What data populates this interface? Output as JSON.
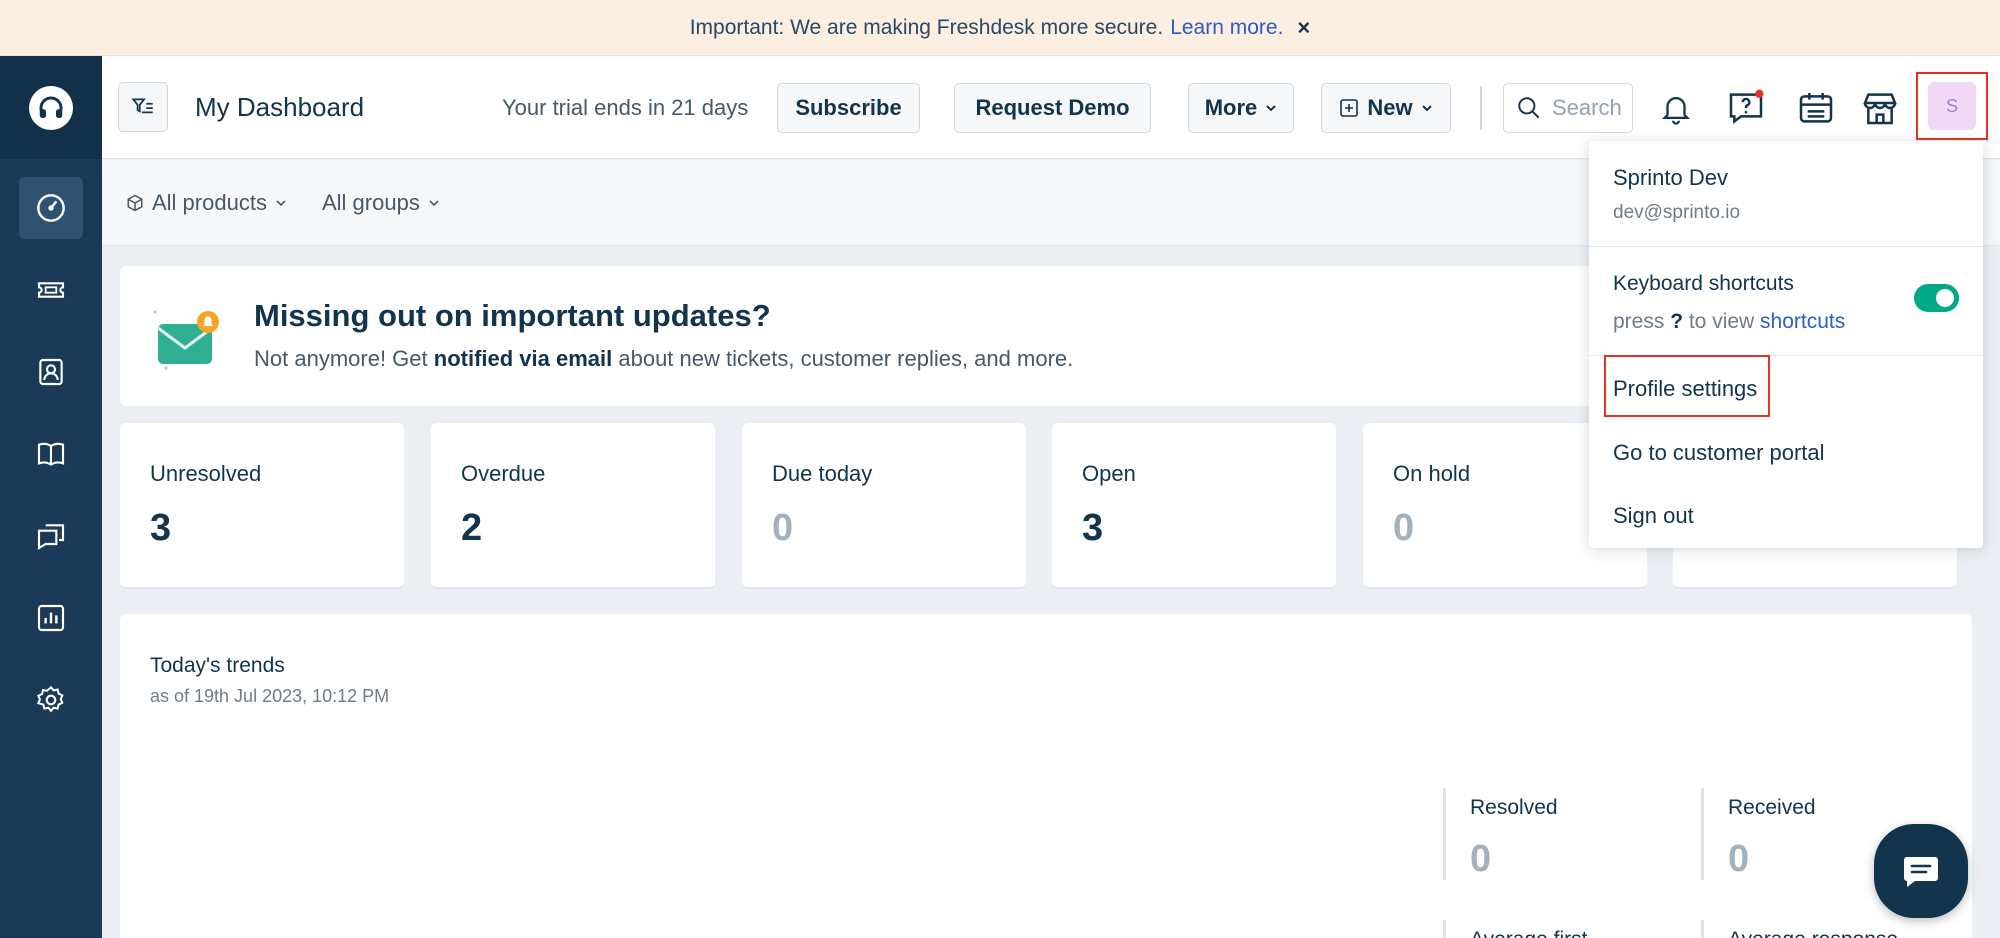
{
  "banner": {
    "text": "Important: We are making Freshdesk more secure.",
    "link": "Learn more.",
    "close": "×"
  },
  "header": {
    "title": "My Dashboard",
    "trial": "Your trial ends in 21 days",
    "subscribe": "Subscribe",
    "request_demo": "Request Demo",
    "more": "More",
    "new": "New",
    "search_placeholder": "Search",
    "avatar_initial": "S"
  },
  "filters": {
    "products": "All products",
    "groups": "All groups"
  },
  "notification": {
    "title": "Missing out on important updates?",
    "text_prefix": "Not anymore! Get ",
    "text_bold": "notified via email",
    "text_suffix": " about new tickets, customer replies, and more."
  },
  "stats": [
    {
      "label": "Unresolved",
      "value": "3"
    },
    {
      "label": "Overdue",
      "value": "2"
    },
    {
      "label": "Due today",
      "value": "0"
    },
    {
      "label": "Open",
      "value": "3"
    },
    {
      "label": "On hold",
      "value": "0"
    }
  ],
  "trends": {
    "title": "Today's trends",
    "subtitle": "as of 19th Jul 2023, 10:12 PM",
    "resolved_label": "Resolved",
    "resolved_value": "0",
    "received_label": "Received",
    "received_value": "0",
    "avg_first_label": "Average first",
    "avg_response_label": "Average response"
  },
  "profile_menu": {
    "name": "Sprinto Dev",
    "email": "dev@sprinto.io",
    "keyboard_shortcuts": "Keyboard shortcuts",
    "press": "press ",
    "key": "?",
    "to_view": " to view ",
    "shortcuts_link": "shortcuts",
    "shortcuts_enabled": true,
    "profile_settings": "Profile settings",
    "customer_portal": "Go to customer portal",
    "sign_out": "Sign out"
  },
  "colors": {
    "sidebar": "#1b3a57",
    "accent_link": "#2c5cc5",
    "toggle_on": "#00a886",
    "highlight": "#e43421"
  }
}
